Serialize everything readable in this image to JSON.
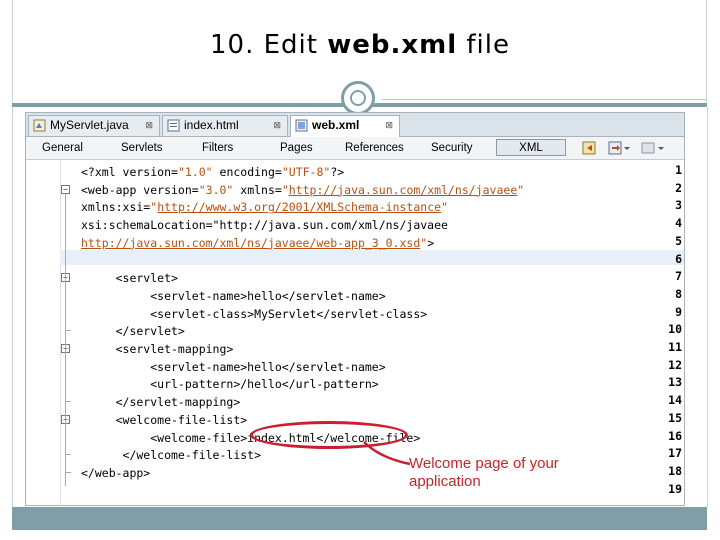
{
  "slide": {
    "title_prefix": "10.  Edit ",
    "title_strong": "web.xml",
    "title_suffix": " file"
  },
  "editor_tabs": [
    {
      "label": "MyServlet.java",
      "close": "⊠",
      "icon": "java-file-icon"
    },
    {
      "label": "index.html",
      "close": "⊠",
      "icon": "html-file-icon"
    },
    {
      "label": "web.xml",
      "close": "⊠",
      "icon": "xml-file-icon",
      "active": true
    }
  ],
  "view_tabs": [
    "General",
    "Servlets",
    "Filters",
    "Pages",
    "References",
    "Security",
    "XML"
  ],
  "toolbar_icons": [
    "back-icon",
    "forward-icon",
    "navigate-icon"
  ],
  "line_numbers": [
    "1",
    "2",
    "3",
    "4",
    "5",
    "6",
    "7",
    "8",
    "9",
    "10",
    "11",
    "12",
    "13",
    "14",
    "15",
    "16",
    "17",
    "18",
    "19"
  ],
  "code_lines": [
    "<?xml version=\"1.0\" encoding=\"UTF-8\"?>",
    "<web-app version=\"3.0\" xmlns=\"http://java.sun.com/xml/ns/javaee\"",
    "xmlns:xsi=\"http://www.w3.org/2001/XMLSchema-instance\"",
    "xsi:schemaLocation=\"http://java.sun.com/xml/ns/javaee",
    "http://java.sun.com/xml/ns/javaee/web-app_3_0.xsd\">",
    "",
    "     <servlet>",
    "          <servlet-name>hello</servlet-name>",
    "          <servlet-class>MyServlet</servlet-class>",
    "     </servlet>",
    "     <servlet-mapping>",
    "          <servlet-name>hello</servlet-name>",
    "          <url-pattern>/hello</url-pattern>",
    "     </servlet-mapping>",
    "     <welcome-file-list>",
    "          <welcome-file>index.html</welcome-file>",
    "      </welcome-file-list>",
    "</web-app>",
    ""
  ],
  "annotation": {
    "line1": "Welcome page of your",
    "line2": "application"
  },
  "colors": {
    "accent": "#7f9ea6",
    "annotation": "#c0272d",
    "string": "#b8500f"
  }
}
